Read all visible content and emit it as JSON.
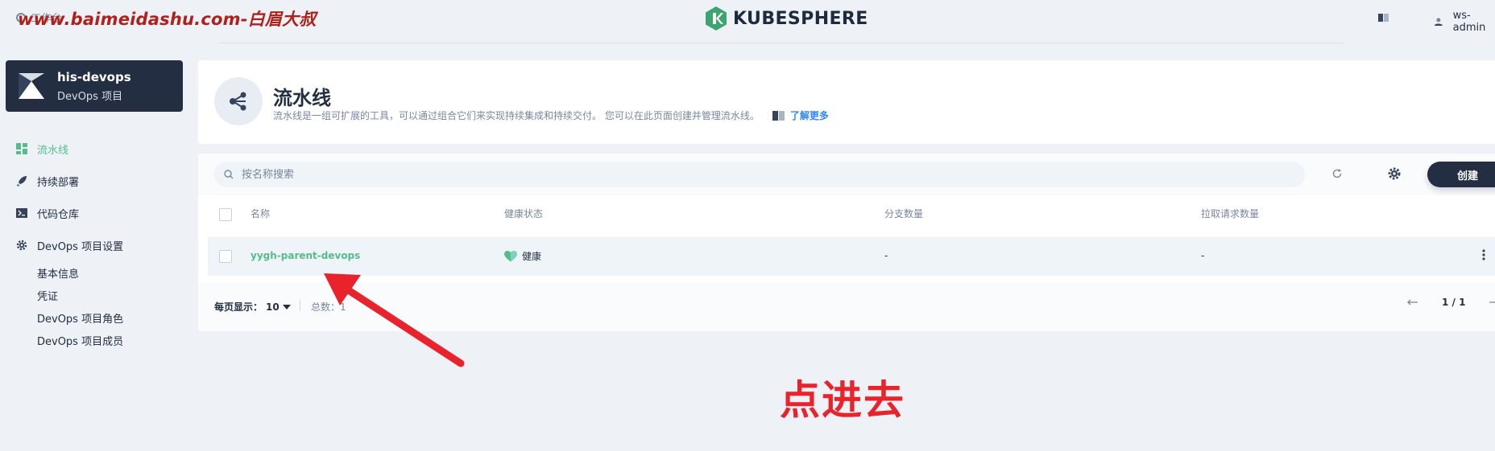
{
  "topbar": {
    "workbench_label": "工作台",
    "watermark": "www.baimeidashu.com-白眉大叔",
    "logo_text": "KUBESPHERE",
    "username": "ws-admin"
  },
  "sidebar": {
    "project_name": "his-devops",
    "project_type": "DevOps 项目",
    "items": [
      {
        "label": "流水线",
        "active": true
      },
      {
        "label": "持续部署"
      },
      {
        "label": "代码仓库"
      },
      {
        "label": "DevOps 项目设置"
      }
    ],
    "settings_items": [
      "基本信息",
      "凭证",
      "DevOps 项目角色",
      "DevOps 项目成员"
    ]
  },
  "header": {
    "title": "流水线",
    "description": "流水线是一组可扩展的工具，可以通过组合它们来实现持续集成和持续交付。 您可以在此页面创建并管理流水线。",
    "learn_more": "了解更多"
  },
  "toolbar": {
    "search_placeholder": "按名称搜索",
    "create_label": "创建"
  },
  "table": {
    "columns": [
      "名称",
      "健康状态",
      "分支数量",
      "拉取请求数量"
    ],
    "rows": [
      {
        "name": "yygh-parent-devops",
        "health": "健康",
        "branches": "-",
        "pull_requests": "-"
      }
    ]
  },
  "footer": {
    "per_page_label": "每页显示：",
    "per_page_value": "10",
    "total_label": "总数：1",
    "page_indicator": "1 / 1"
  },
  "annotation": {
    "text": "点进去",
    "color": "#e8232b"
  },
  "colors": {
    "accent_green": "#55bc8a",
    "dark": "#242e42",
    "muted": "#79879c",
    "background": "#eef2f6"
  }
}
